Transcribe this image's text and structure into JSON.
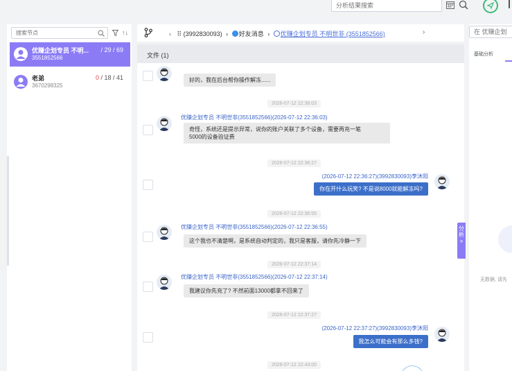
{
  "topbar": {
    "search_placeholder": "分析结果搜索"
  },
  "sidebar": {
    "search_placeholder": "搜索节点",
    "sort_label": "↑↓",
    "contacts": [
      {
        "name": "优赚企划专员 不明...",
        "id": "3551852566",
        "unread": "",
        "count": "/ 29 / 69"
      },
      {
        "name": "老弟",
        "id": "3670298325",
        "unread": "0",
        "count": "/ 18 / 41"
      }
    ]
  },
  "header": {
    "crumb_1": "⠿ (3992830093)",
    "crumb_2": "好友消息",
    "crumb_3": "优赚企划专员 不明世非 (3551852566)"
  },
  "file_bar": {
    "label": "文件 (1)"
  },
  "messages": [
    {
      "text": "好的，我在后台帮你操作解冻......"
    },
    {
      "timestamp": "2026-07-12 22:36:03",
      "sender": "优赚企划专员 不明世非(3551852566)(2026-07-12 22:36:03)",
      "text_1": "奇怪，系统还是提示异常，说你的账户关联了多个设备，需要再充一笔",
      "text_2": "5000的设备验证费"
    },
    {
      "timestamp": "2026-07-12 22:36:27",
      "sender": "(2026-07-12 22:36:27)(3992830093)李沐阳",
      "text": "你在开什么玩笑? 不是说8000就能解冻吗?"
    },
    {
      "timestamp": "2026-07-12 22:36:55",
      "sender": "优赚企划专员 不明世非(3551852566)(2026-07-12 22:36:55)",
      "text": "这个我也不清楚啊，是系统自动判定的，我只是客服，请你先冷静一下"
    },
    {
      "timestamp": "2026-07-12 22:37:14",
      "sender": "优赚企划专员 不明世非(3551852566)(2026-07-12 22:37:14)",
      "text": "我建议你先充了? 不然前面13000都拿不回来了"
    },
    {
      "timestamp": "2026-07-12 22:37:27",
      "sender": "(2026-07-12 22:37:27)(3992830093)李沐阳",
      "text": "我怎么可能会有那么多钱?"
    },
    {
      "timestamp": "2026-07-12 22:43:00"
    }
  ],
  "analyse_tab": {
    "char_1": "分",
    "char_2": "析",
    "char_3": "»"
  },
  "right_panel": {
    "search_placeholder": "在 优赚企划",
    "tab_basic": "基础分析",
    "empty_text": "无数据, 请先"
  },
  "colors": {
    "accent": "#8b7cf6",
    "link": "#3a64c8",
    "bubble_out": "#3c6fc9",
    "bubble_in": "#e9e9ea"
  }
}
